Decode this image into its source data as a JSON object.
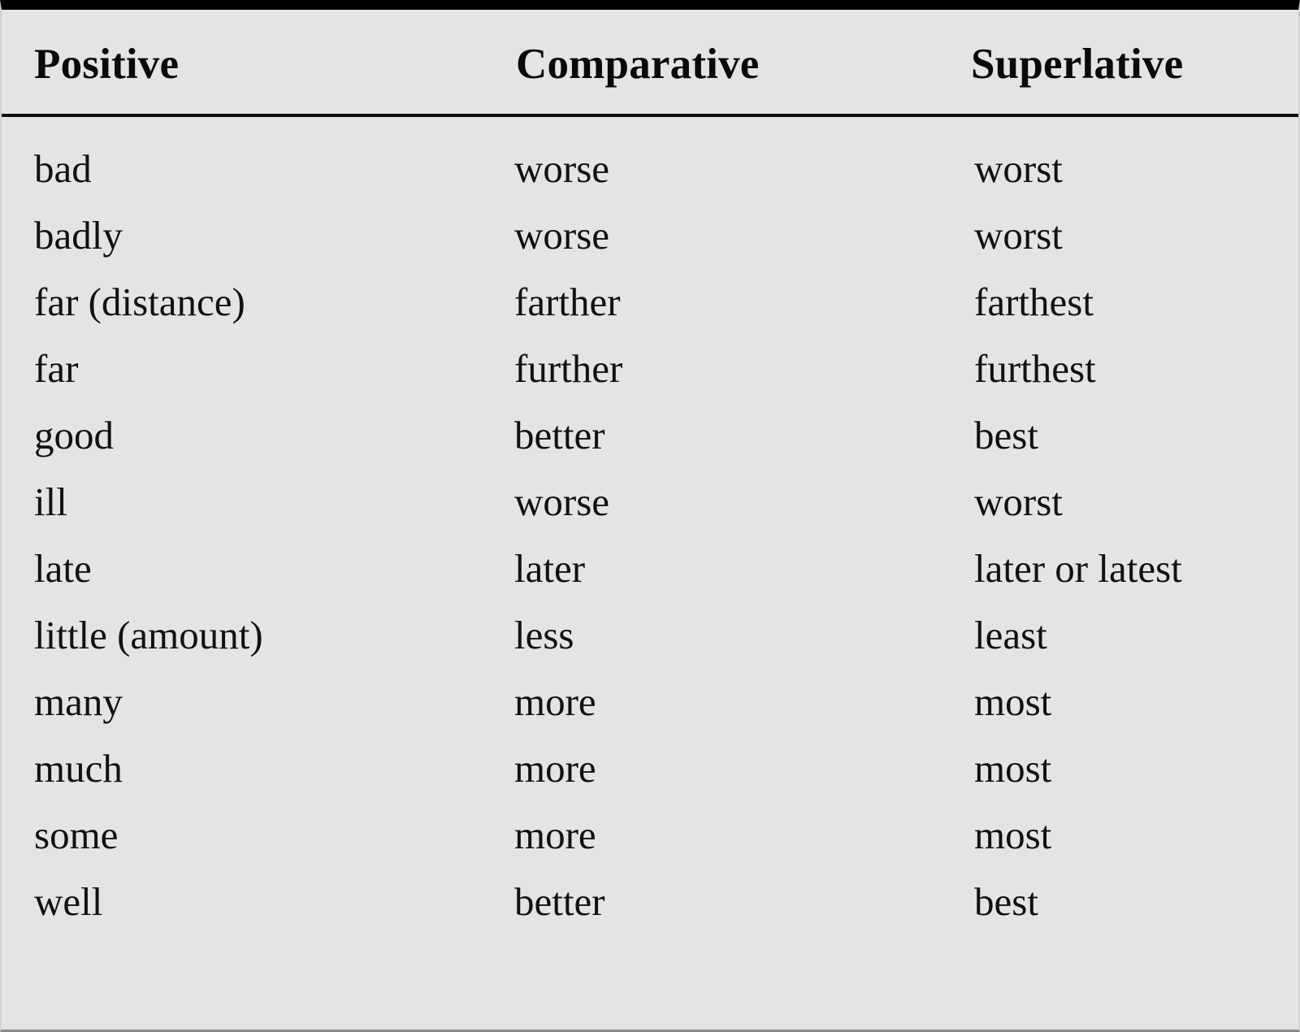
{
  "table": {
    "columns": [
      {
        "key": "positive",
        "label": "Positive"
      },
      {
        "key": "comparative",
        "label": "Comparative"
      },
      {
        "key": "superlative",
        "label": "Superlative"
      }
    ],
    "rows": [
      {
        "positive": "bad",
        "comparative": "worse",
        "superlative": "worst"
      },
      {
        "positive": "badly",
        "comparative": "worse",
        "superlative": "worst"
      },
      {
        "positive": "far (distance)",
        "comparative": "farther",
        "superlative": "farthest"
      },
      {
        "positive": "far",
        "comparative": "further",
        "superlative": "furthest"
      },
      {
        "positive": "good",
        "comparative": "better",
        "superlative": "best"
      },
      {
        "positive": "ill",
        "comparative": "worse",
        "superlative": "worst"
      },
      {
        "positive": "late",
        "comparative": "later",
        "superlative": "later or latest"
      },
      {
        "positive": "little (amount)",
        "comparative": "less",
        "superlative": "least"
      },
      {
        "positive": "many",
        "comparative": "more",
        "superlative": "most"
      },
      {
        "positive": "much",
        "comparative": "more",
        "superlative": "most"
      },
      {
        "positive": "some",
        "comparative": "more",
        "superlative": "most"
      },
      {
        "positive": "well",
        "comparative": "better",
        "superlative": "best"
      }
    ]
  },
  "style": {
    "background": "#e4e4e4",
    "text_color": "#111111",
    "top_rule_color": "#000000",
    "header_rule_color": "#111111",
    "bottom_rule_color": "#8a8a8a"
  }
}
